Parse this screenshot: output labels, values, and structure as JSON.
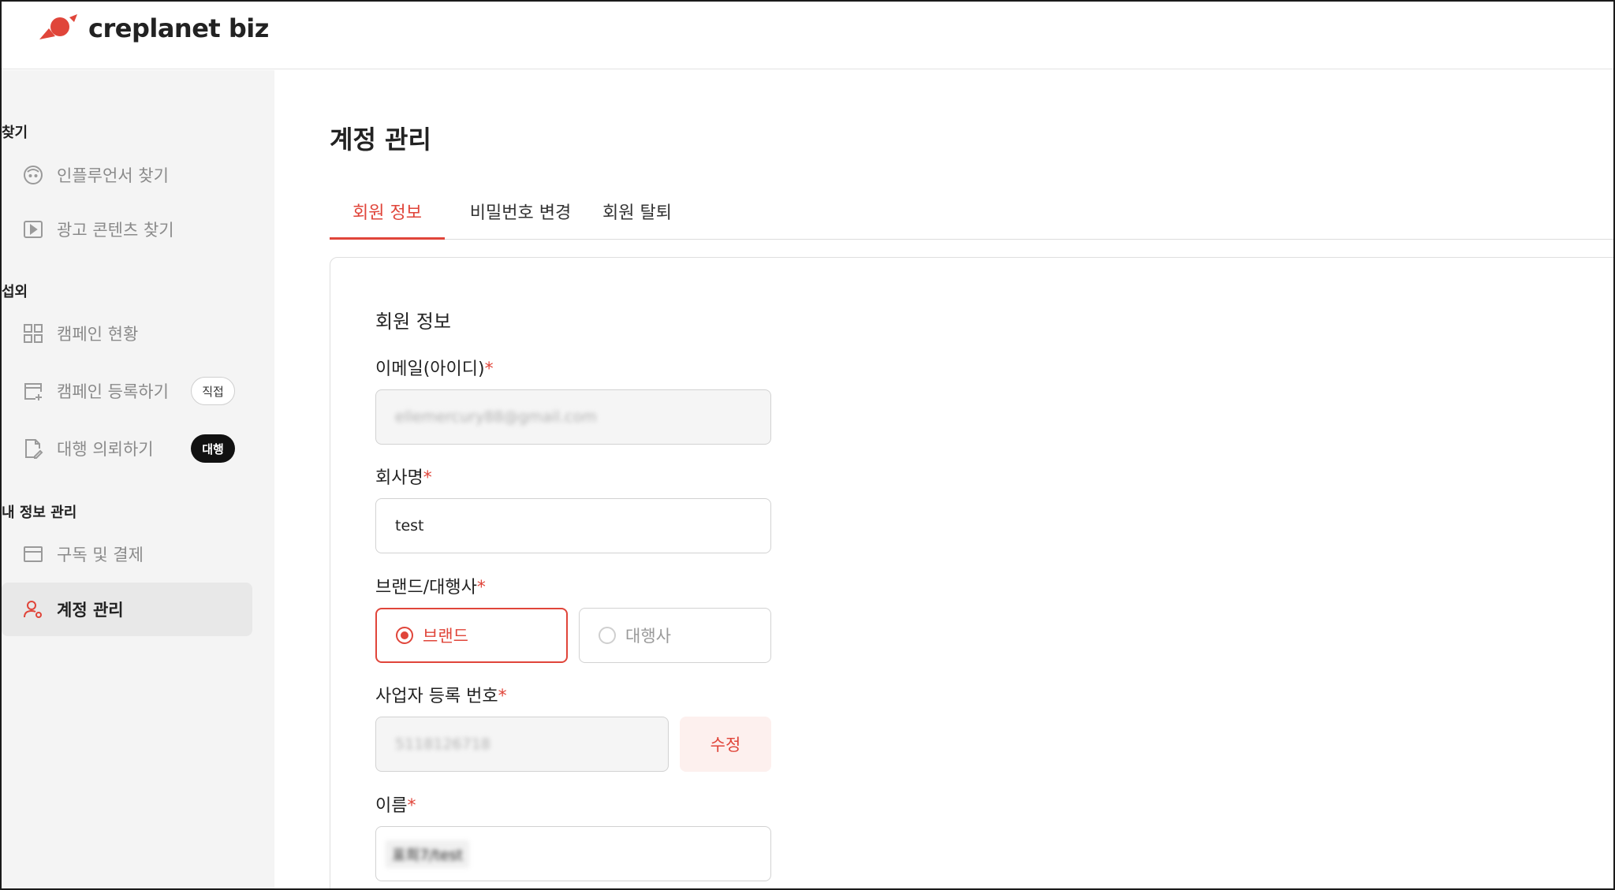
{
  "brand": {
    "name": "creplanet biz",
    "accent_color": "#e0453a"
  },
  "sidebar": {
    "sections": [
      {
        "label": "찾기"
      },
      {
        "label": "섭외"
      },
      {
        "label": "내 정보 관리"
      }
    ],
    "items": [
      {
        "label": "인플루언서 찾기",
        "icon": "face-icon"
      },
      {
        "label": "광고 콘텐츠 찾기",
        "icon": "play-square-icon"
      },
      {
        "label": "캠페인 현황",
        "icon": "grid-icon"
      },
      {
        "label": "캠페인 등록하기",
        "icon": "add-calendar-icon",
        "badge": "직접"
      },
      {
        "label": "대행 의뢰하기",
        "icon": "document-edit-icon",
        "badge": "대행"
      },
      {
        "label": "구독 및 결제",
        "icon": "card-icon"
      },
      {
        "label": "계정 관리",
        "icon": "user-settings-icon",
        "active": true
      }
    ]
  },
  "main": {
    "title": "계정 관리",
    "tabs": [
      {
        "label": "회원 정보",
        "active": true
      },
      {
        "label": "비밀번호 변경"
      },
      {
        "label": "회원 탈퇴"
      }
    ],
    "card_title": "회원 정보",
    "fields": {
      "email": {
        "label": "이메일(아이디)",
        "required": "*",
        "value": "ellemercury88@gmail.com"
      },
      "company": {
        "label": "회사명",
        "required": "*",
        "value": "test"
      },
      "brand_type": {
        "label": "브랜드/대행사",
        "required": "*",
        "options": [
          "브랜드",
          "대행사"
        ],
        "selected": "브랜드"
      },
      "biz_number": {
        "label": "사업자 등록 번호",
        "required": "*",
        "value": "5118126718",
        "edit_label": "수정"
      },
      "name": {
        "label": "이름",
        "required": "*",
        "value": "표희7/test"
      }
    }
  }
}
